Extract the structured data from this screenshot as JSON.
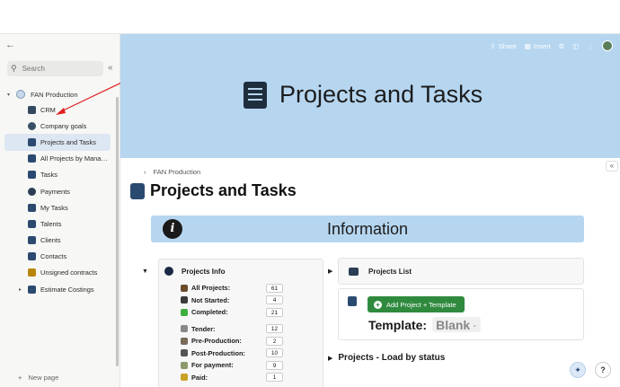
{
  "sidebar": {
    "search_placeholder": "Search",
    "space_name": "FAN Production",
    "items": [
      {
        "label": "CRM",
        "icon": "crm-icon"
      },
      {
        "label": "Company goals",
        "icon": "target-icon"
      },
      {
        "label": "Projects and Tasks",
        "icon": "clipboard-list-icon",
        "active": true
      },
      {
        "label": "All Projects by Mana…",
        "icon": "clipboard-list-icon"
      },
      {
        "label": "Tasks",
        "icon": "clipboard-list-icon"
      },
      {
        "label": "Payments",
        "icon": "dollar-icon"
      },
      {
        "label": "My Tasks",
        "icon": "clipboard-list-icon"
      },
      {
        "label": "Talents",
        "icon": "people-icon"
      },
      {
        "label": "Clients",
        "icon": "people-icon"
      },
      {
        "label": "Contacts",
        "icon": "contact-book-icon"
      },
      {
        "label": "Unsigned contracts",
        "icon": "signature-icon"
      },
      {
        "label": "Estimate Costings",
        "icon": "calculator-icon",
        "expandable": true
      }
    ],
    "new_page": "New page"
  },
  "toolbar": {
    "share": "Share",
    "insert": "Insert"
  },
  "cover": {
    "title": "Projects and Tasks"
  },
  "page": {
    "breadcrumb": "FAN Production",
    "title": "Projects and Tasks",
    "info_banner": "Information"
  },
  "projects_info": {
    "heading": "Projects Info",
    "stats_group1": [
      {
        "label": "All Projects:",
        "value": "61"
      },
      {
        "label": "Not Started:",
        "value": "4"
      },
      {
        "label": "Completed:",
        "value": "21"
      }
    ],
    "stats_group2": [
      {
        "label": "Tender:",
        "value": "12"
      },
      {
        "label": "Pre-Production:",
        "value": "2"
      },
      {
        "label": "Post-Production:",
        "value": "10"
      },
      {
        "label": "For payment:",
        "value": "9"
      },
      {
        "label": "Paid:",
        "value": "1"
      }
    ]
  },
  "projects_list": {
    "heading": "Projects List",
    "add_button": "Add Project + Template",
    "template_label": "Template:",
    "template_value": "Blank"
  },
  "load_status": "Projects - Load by status",
  "colors": {
    "cover_bg": "#b6d6f0",
    "add_button": "#2f8a3e",
    "active_nav": "#dde7f3",
    "annotation_arrow": "#e02020"
  }
}
